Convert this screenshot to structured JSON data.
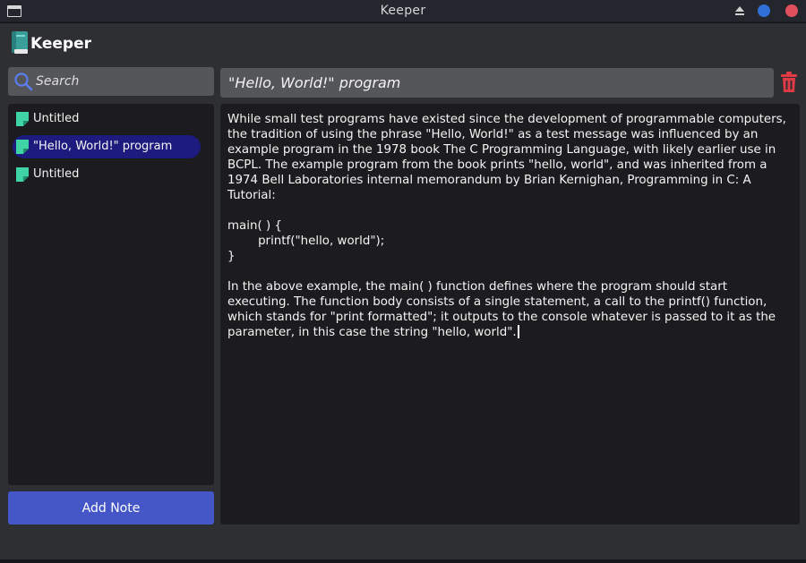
{
  "window": {
    "title": "Keeper",
    "colors": {
      "close": "#e0505c",
      "maximize": "#2f6fd6"
    },
    "icons": [
      "window-menu-icon",
      "collapse-icon",
      "maximize-icon",
      "close-icon"
    ]
  },
  "app": {
    "name": "Keeper",
    "logo_icon": "book-icon"
  },
  "sidebar": {
    "search": {
      "placeholder": "Search",
      "value": "",
      "icon": "search-icon"
    },
    "notes": [
      {
        "label": "Untitled",
        "selected": false,
        "icon": "note-icon"
      },
      {
        "label": "\"Hello, World!\" program",
        "selected": true,
        "icon": "note-icon"
      },
      {
        "label": "Untitled",
        "selected": false,
        "icon": "note-icon"
      }
    ],
    "add_button_label": "Add Note",
    "accent": "#4557c7",
    "selected_color": "#1d1b7e"
  },
  "editor": {
    "title": "\"Hello, World!\" program",
    "delete_icon": "trash-icon",
    "delete_color": "#e03a45",
    "paragraphs": [
      "While small test programs have existed since the development of programmable computers, the tradition of using the phrase \"Hello, World!\" as a test message was influenced by an example program in the 1978 book The C Programming Language, with likely earlier use in BCPL. The example program from the book prints \"hello, world\", and was inherited from a 1974 Bell Laboratories internal memorandum by Brian Kernighan, Programming in C: A Tutorial:",
      "main( ) {\n        printf(\"hello, world\");\n}",
      "In the above example, the main( ) function defines where the program should start executing. The function body consists of a single statement, a call to the printf() function, which stands for \"print formatted\"; it outputs to the console whatever is passed to it as the parameter, in this case the string \"hello, world\"."
    ]
  }
}
